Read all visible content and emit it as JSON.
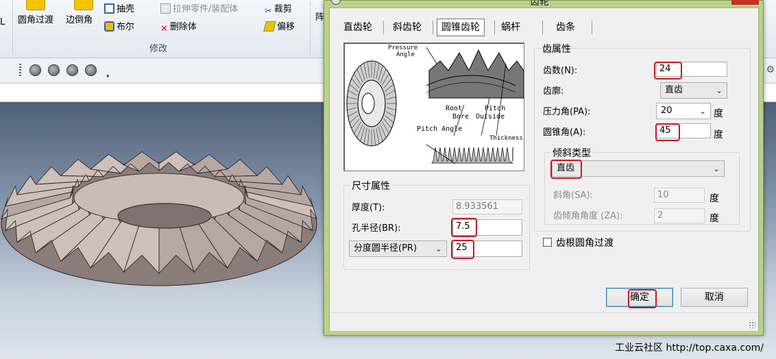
{
  "ribbon": {
    "cut_left": "L",
    "fillet": "圆角过渡",
    "chamfer": "边倒角",
    "shell": "抽壳",
    "boolean": "布尔",
    "stretch": "拉伸零件/装配体",
    "delete_body": "删除体",
    "trim": "裁剪",
    "offset": "偏移",
    "group_label": "修改",
    "cut_right": "阵"
  },
  "watermark": "工业云社区 http://top.caxa.com/",
  "dialog": {
    "title": "齿轮",
    "tabs": [
      "直齿轮",
      "斜齿轮",
      "圆锥齿轮",
      "蜗杆",
      "齿条"
    ],
    "active_tab": "圆锥齿轮",
    "preview": {
      "pressure_angle": "Pressure\nAngle",
      "root": "Root",
      "pitch": "Pitch",
      "bore": "Bore",
      "outside": "Outside",
      "pitch_angle": "Pitch Angle",
      "thickness": "Thickness"
    },
    "tooth_props": {
      "legend": "齿属性",
      "teeth_label": "齿数(N):",
      "teeth_value": "24",
      "profile_label": "齿廓:",
      "profile_value": "直齿",
      "pressure_label": "压力角(PA):",
      "pressure_value": "20",
      "pressure_unit": "度",
      "cone_label": "圆锥角(A):",
      "cone_value": "45",
      "cone_unit": "度"
    },
    "helix": {
      "legend": "倾斜类型",
      "type_value": "直齿",
      "helix_angle_label": "斜角(SA):",
      "helix_angle_value": "10",
      "helix_angle_unit": "度",
      "tooth_tilt_label": "齿倾角角度 (ZA):",
      "tooth_tilt_value": "2",
      "tooth_tilt_unit": "度"
    },
    "root_fillet_label": "齿根圆角过渡",
    "root_fillet_checked": false,
    "size_props": {
      "legend": "尺寸属性",
      "thickness_label": "厚度(T):",
      "thickness_value": "8.933561",
      "bore_label": "孔半径(BR):",
      "bore_value": "7.5",
      "pitch_radius_label": "分度圆半径(PR)",
      "pitch_radius_value": "25"
    },
    "ok_label": "确定",
    "cancel_label": "取消"
  },
  "colors": {
    "dialog_frame": "#b9d18a",
    "highlight": "#c8171e",
    "close_button": "#c8312a",
    "viewport_top": "#4e5f78",
    "gear_face": "#c9bcb6"
  }
}
